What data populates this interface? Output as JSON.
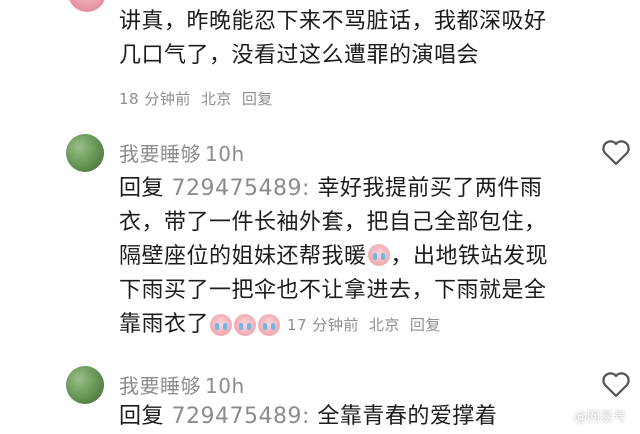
{
  "comment_top": {
    "text_line1": "讲真，昨晚能忍下来不骂脏话，我都深吸好",
    "text_line2": "几口气了，没看过这么遭罪的演唱会",
    "time": "18 分钟前",
    "location": "北京",
    "reply_label": "回复"
  },
  "reply1": {
    "username": "我要睡够",
    "time_short": "10h",
    "reply_prefix": "回复",
    "reply_to": "729475489:",
    "line1": "幸好我提前买了两件雨",
    "line2": "衣，带了一件长袖外套，把自己全部包住，",
    "line3a": "隔壁座位的姐妹还帮我暖",
    "line3b": "，出地铁站发现",
    "line4": "下雨买了一把伞也不让拿进去，下雨就是全",
    "line5": "靠雨衣了",
    "time": "17 分钟前",
    "location": "北京",
    "reply_label": "回复"
  },
  "reply2": {
    "username": "我要睡够",
    "time_short": "10h",
    "reply_prefix": "回复",
    "reply_to": "729475489:",
    "text": "全靠青春的爱撑着"
  },
  "icons": {
    "like": "heart-outline-icon",
    "emoji": "crying-emoji-icon"
  },
  "watermark": "@网易号"
}
